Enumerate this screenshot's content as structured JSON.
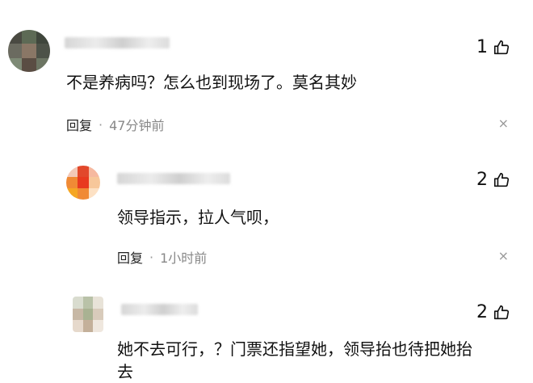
{
  "comments": [
    {
      "likes": "1",
      "text": "不是养病吗？怎么也到现场了。莫名其妙",
      "reply_label": "回复",
      "dot": "·",
      "time": "47分钟前",
      "close_icon": "×"
    },
    {
      "likes": "2",
      "text": "领导指示，拉人气呗，",
      "reply_label": "回复",
      "dot": "·",
      "time": "1小时前",
      "close_icon": "×"
    },
    {
      "likes": "2",
      "text": "她不去可行，？门票还指望她，领导抬也待把她抬",
      "text_overflow": "去"
    }
  ],
  "icons": {
    "like": "thumbs-up-icon",
    "close": "close-icon"
  }
}
